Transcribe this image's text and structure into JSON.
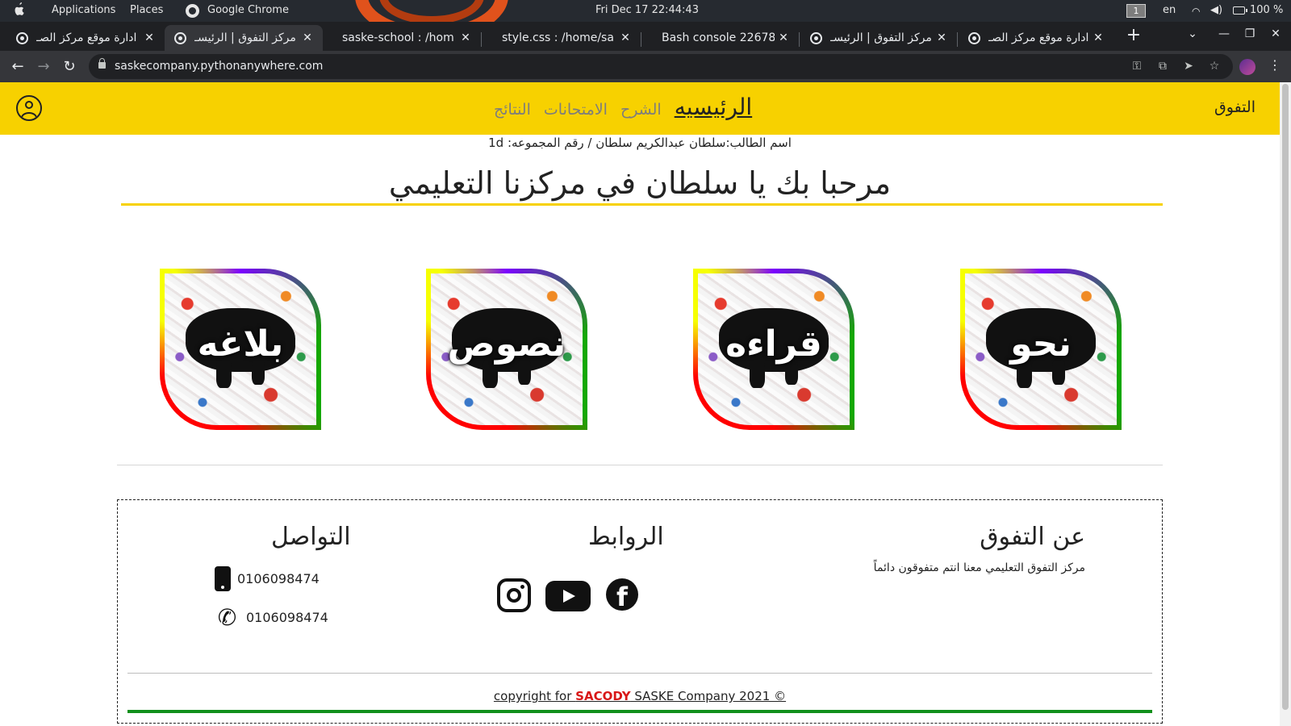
{
  "os": {
    "applications": "Applications",
    "places": "Places",
    "active_app": "Google Chrome",
    "clock": "Fri Dec 17  22:44:43",
    "workspace": "1",
    "lang": "en",
    "battery": "100 %"
  },
  "browser": {
    "tabs": [
      {
        "title": "ادارة موقع مركز الصـ",
        "favicon": "globe-icon"
      },
      {
        "title": "مركز التفوق | الرئيسـ",
        "favicon": "globe-icon"
      },
      {
        "title": "saske-school : /hom",
        "favicon": "none"
      },
      {
        "title": "style.css : /home/sa",
        "favicon": "none"
      },
      {
        "title": "Bash console 22678",
        "favicon": "none"
      },
      {
        "title": "مركز التفوق | الرئيسـ",
        "favicon": "globe-icon"
      },
      {
        "title": "ادارة موقع مركز الصـ",
        "favicon": "globe-icon"
      }
    ],
    "url": "saskecompany.pythonanywhere.com"
  },
  "site": {
    "brand": "التفوق",
    "nav": [
      {
        "label": "الرئيسيه",
        "active": true
      },
      {
        "label": "الشرح",
        "active": false
      },
      {
        "label": "الامتحانات",
        "active": false
      },
      {
        "label": "النتائج",
        "active": false
      }
    ],
    "student_info": "اسم الطالب:سلطان عبدالكريم سلطان / رقم المجموعه: 1d",
    "welcome": "مرحبا بك يا سلطان في مركزنا التعليمي",
    "cards": [
      "نحو",
      "قراءه",
      "نصوص",
      "بلاغه"
    ],
    "footer": {
      "about_title": "عن التفوق",
      "about_text": "مركز التفوق التعليمي معنا انتم متفوقون دائماً",
      "links_title": "الروابط",
      "contact_title": "التواصل",
      "mobile": "0106098474",
      "phone": "0106098474",
      "copyright_prefix": "copyright for ",
      "copyright_brand": "SACODY",
      "copyright_suffix": " SASKE Company 2021 ©"
    }
  },
  "colors": {
    "nav_yellow": "#f7d100",
    "footer_green": "#11901c",
    "brand_red": "#d81818"
  }
}
